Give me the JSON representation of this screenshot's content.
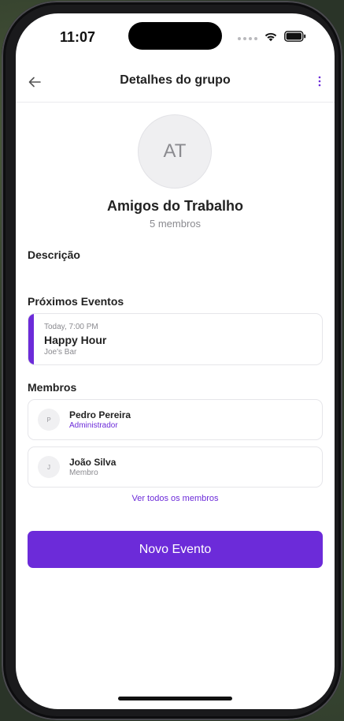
{
  "status_bar": {
    "time": "11:07"
  },
  "header": {
    "title": "Detalhes do grupo"
  },
  "group": {
    "initials": "AT",
    "name": "Amigos do Trabalho",
    "member_count": "5 membros"
  },
  "sections": {
    "description_label": "Descrição",
    "events_label": "Próximos Eventos",
    "members_label": "Membros"
  },
  "event": {
    "time": "Today, 7:00 PM",
    "title": "Happy Hour",
    "place": "Joe's Bar"
  },
  "members": [
    {
      "initial": "P",
      "name": "Pedro Pereira",
      "role": "Administrador"
    },
    {
      "initial": "J",
      "name": "João Silva",
      "role": "Membro"
    }
  ],
  "view_all_label": "Ver todos os membros",
  "new_event_label": "Novo Evento",
  "colors": {
    "accent": "#6c2bd9",
    "text_primary": "#222222",
    "text_secondary": "#8a8a8f"
  },
  "icons": {
    "back": "arrow-left-icon",
    "more": "more-vertical-icon",
    "wifi": "wifi-icon",
    "battery": "battery-icon"
  }
}
